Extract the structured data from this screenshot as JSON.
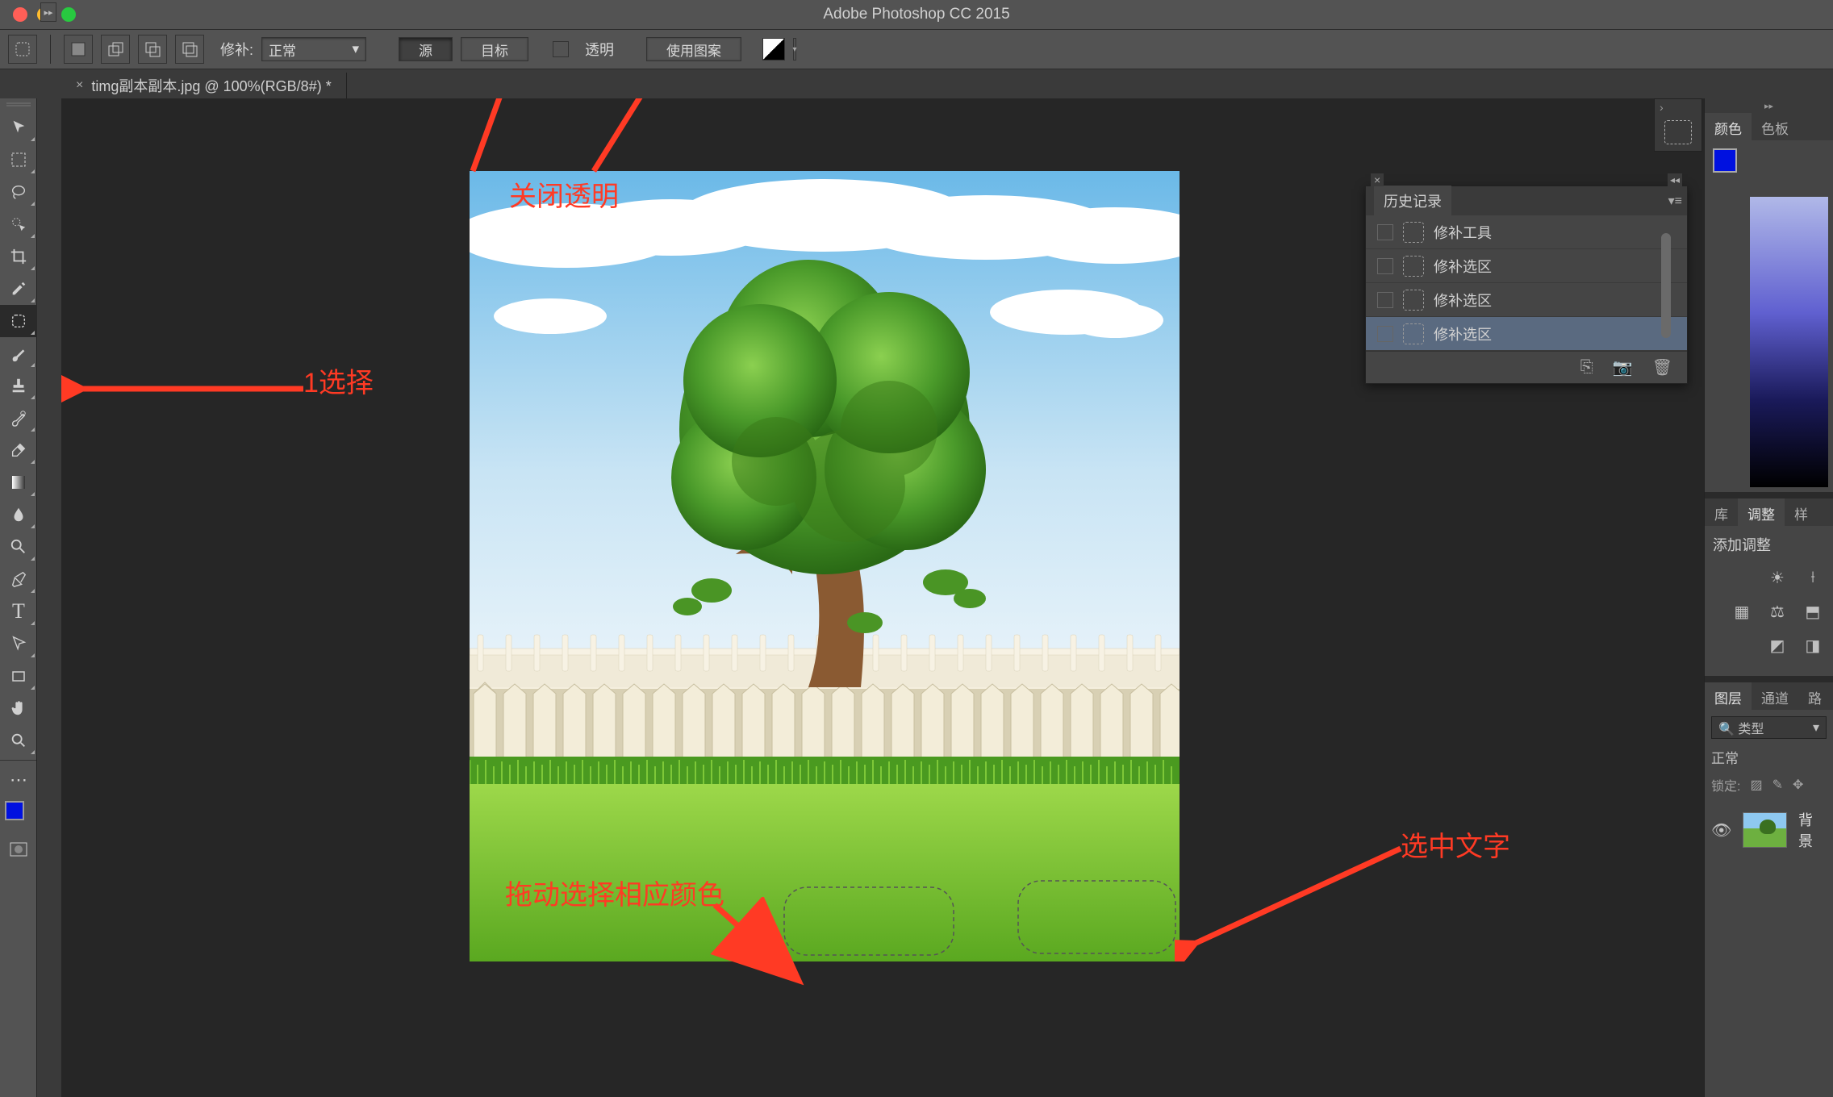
{
  "app_title": "Adobe Photoshop CC 2015",
  "doc_tab": "timg副本副本.jpg @ 100%(RGB/8#) *",
  "options_bar": {
    "healing_label": "修补:",
    "mode_dropdown": "正常",
    "source_btn": "源",
    "target_btn": "目标",
    "transparent_label": "透明",
    "use_pattern_btn": "使用图案"
  },
  "annotations": {
    "close_transparent": "关闭透明",
    "select_tool": "1选择",
    "drag_color": "拖动选择相应颜色",
    "select_text": "选中文字"
  },
  "history_panel": {
    "title": "历史记录",
    "items": [
      "修补工具",
      "修补选区",
      "修补选区",
      "修补选区"
    ]
  },
  "right_panels": {
    "color_tab": "颜色",
    "swatches_tab": "色板",
    "lib_tab": "库",
    "adjust_tab": "调整",
    "style_tab": "样",
    "add_adjust": "添加调整",
    "layers_tab": "图层",
    "channels_tab": "通道",
    "paths_tab": "路",
    "layer_filter": "类型",
    "blend_mode": "正常",
    "lock_label": "锁定:",
    "layer_name": "背景"
  },
  "tools": [
    "move",
    "marquee",
    "lasso",
    "quick-select",
    "crop",
    "eyedropper",
    "patch",
    "brush",
    "stamp",
    "history-brush",
    "eraser",
    "gradient",
    "blur",
    "dodge",
    "pen",
    "type",
    "path-select",
    "rectangle",
    "hand",
    "zoom"
  ]
}
